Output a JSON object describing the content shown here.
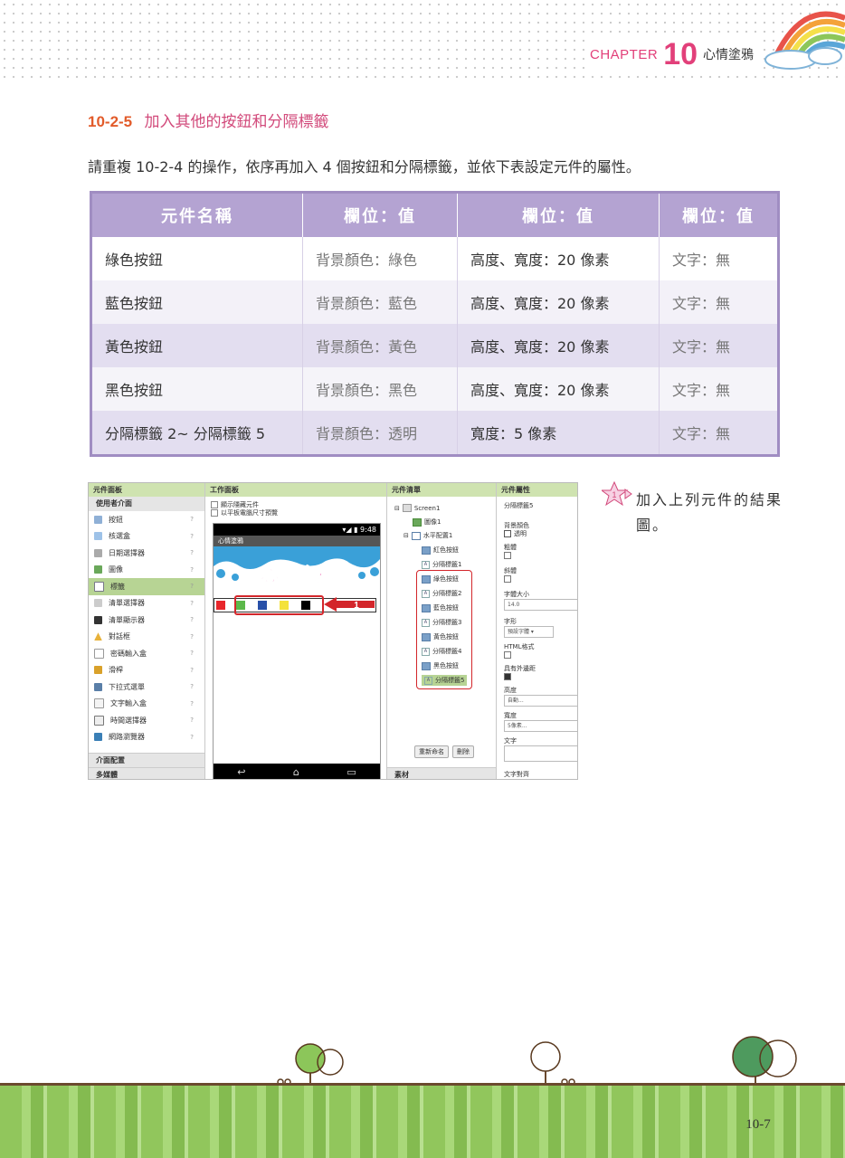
{
  "header": {
    "chapter_word": "CHAPTER",
    "chapter_number": "10",
    "chapter_title": "心情塗鴉"
  },
  "section": {
    "number": "10-2-5",
    "title": "加入其他的按鈕和分隔標籤"
  },
  "paragraph": "請重複 10-2-4 的操作，依序再加入 4 個按鈕和分隔標籤，並依下表設定元件的屬性。",
  "table": {
    "headers": [
      "元件名稱",
      "欄位：值",
      "欄位：值",
      "欄位：值"
    ],
    "rows": [
      [
        "綠色按鈕",
        "背景顏色：綠色",
        "高度、寬度：20 像素",
        "文字：無"
      ],
      [
        "藍色按鈕",
        "背景顏色：藍色",
        "高度、寬度：20 像素",
        "文字：無"
      ],
      [
        "黃色按鈕",
        "背景顏色：黃色",
        "高度、寬度：20 像素",
        "文字：無"
      ],
      [
        "黑色按鈕",
        "背景顏色：黑色",
        "高度、寬度：20 像素",
        "文字：無"
      ],
      [
        "分隔標籤 2~ 分隔標籤 5",
        "背景顏色：透明",
        "寬度：5 像素",
        "文字：無"
      ]
    ]
  },
  "screenshot": {
    "palette": {
      "header": "元件面板",
      "group": "使用者介面",
      "items": [
        "按鈕",
        "核選盒",
        "日期選擇器",
        "圖像",
        "標籤",
        "清單選擇器",
        "清單顯示器",
        "對話框",
        "密碼輸入盒",
        "滑桿",
        "下拉式選單",
        "文字輸入盒",
        "時間選擇器",
        "網路瀏覽器"
      ],
      "footer1": "介面配置",
      "footer2": "多媒體"
    },
    "viewer": {
      "header": "工作面板",
      "checkbox1": "顯示隱藏元件",
      "checkbox2": "以平板電腦尺寸預覽",
      "status_time": "9:48",
      "app_title": "心情塗鴉",
      "banner_text": "心情塗鴉",
      "marker": "1"
    },
    "components": {
      "header": "元件清單",
      "items": [
        "Screen1",
        "圖像1",
        "水平配置1",
        "紅色按鈕",
        "分隔標籤1",
        "綠色按鈕",
        "分隔標籤2",
        "藍色按鈕",
        "分隔標籤3",
        "黃色按鈕",
        "分隔標籤4",
        "黑色按鈕",
        "分隔標籤5"
      ],
      "rename_button": "重新命名",
      "delete_button": "刪除",
      "media_header": "素材"
    },
    "properties": {
      "header": "元件屬性",
      "component": "分隔標籤5",
      "bg_label": "背景顏色",
      "bg_value": "透明",
      "bold_label": "粗體",
      "italic_label": "斜體",
      "fontsize_label": "字體大小",
      "fontsize_value": "14.0",
      "font_label": "字形",
      "font_value": "預設字體 ▾",
      "html_label": "HTML格式",
      "margin_label": "具有外邊距",
      "height_label": "高度",
      "height_value": "自動...",
      "width_label": "寬度",
      "width_value": "5像素...",
      "text_label": "文字",
      "text_align_label": "文字對齊"
    }
  },
  "callout": {
    "number": "1",
    "text": "加入上列元件的結果圖。"
  },
  "page_number": "10-7",
  "colors": {
    "accent_pink": "#e2407a",
    "table_header": "#b4a3d2",
    "highlight_red": "#d3262b",
    "pane_header_green": "#cfe3b0"
  }
}
